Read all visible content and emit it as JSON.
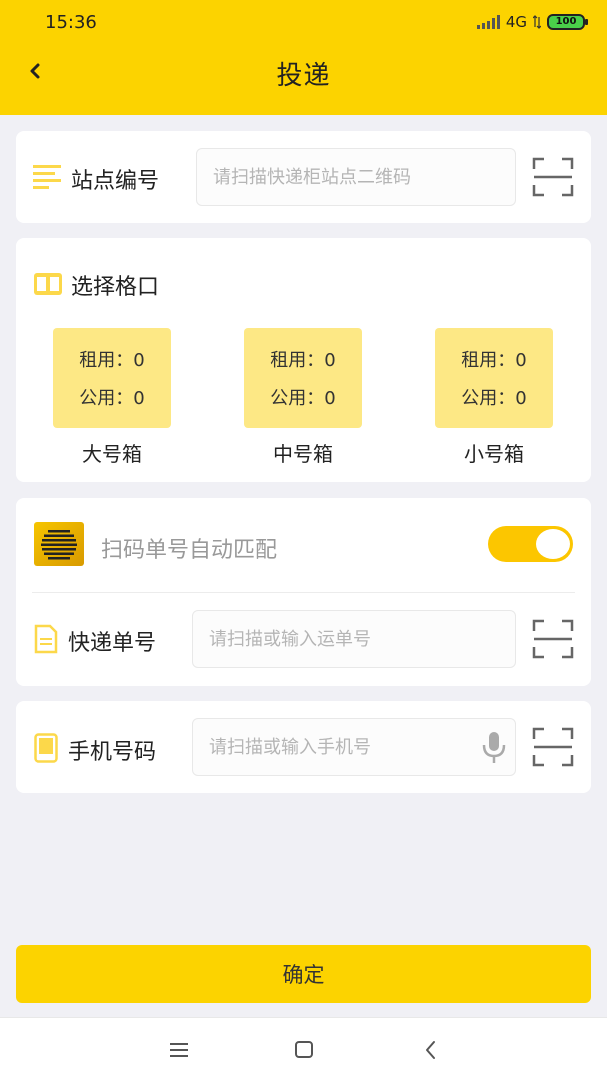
{
  "status_bar": {
    "time": "15:36",
    "network": "4G",
    "battery": "100"
  },
  "header": {
    "title": "投递",
    "back_icon": "chevron-left-icon"
  },
  "station": {
    "label": "站点编号",
    "placeholder": "请扫描快递柜站点二维码",
    "icon": "list-lines-icon",
    "scan_icon": "scan-frame-icon"
  },
  "slot_section": {
    "title": "选择格口",
    "icon": "grid-icon",
    "slots": [
      {
        "rent_label": "租用：",
        "rent_value": "0",
        "public_label": "公用：",
        "public_value": "0",
        "name": "大号箱"
      },
      {
        "rent_label": "租用：",
        "rent_value": "0",
        "public_label": "公用：",
        "public_value": "0",
        "name": "中号箱"
      },
      {
        "rent_label": "租用：",
        "rent_value": "0",
        "public_label": "公用：",
        "public_value": "0",
        "name": "小号箱"
      }
    ]
  },
  "auto_match": {
    "label": "扫码单号自动匹配",
    "enabled": true,
    "icon": "barcode-badge-icon"
  },
  "tracking": {
    "label": "快递单号",
    "placeholder": "请扫描或输入运单号",
    "icon": "document-icon",
    "scan_icon": "scan-frame-icon"
  },
  "phone": {
    "label": "手机号码",
    "placeholder": "请扫描或输入手机号",
    "icon": "phone-icon",
    "mic_icon": "microphone-icon",
    "scan_icon": "scan-frame-icon"
  },
  "confirm_label": "确定",
  "colors": {
    "brand_yellow": "#fcd300",
    "slot_yellow": "#fde885",
    "toggle_on": "#fcc600",
    "background": "#f0f0f5"
  },
  "nav_bar": {
    "menu_icon": "menu-icon",
    "home_icon": "home-square-icon",
    "back_icon": "back-chevron-icon"
  }
}
